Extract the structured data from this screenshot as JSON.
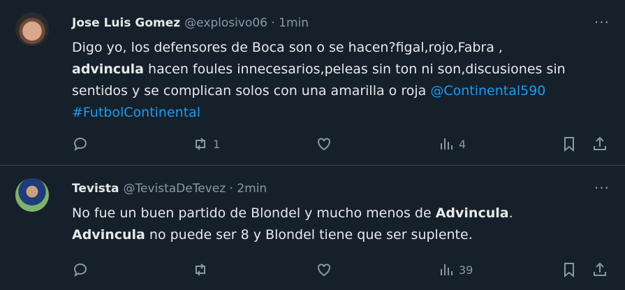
{
  "tweets": [
    {
      "name": "Jose Luis Gomez",
      "handle": "@explosivo06 · 1min",
      "more": "···",
      "body1": "Digo yo, los defensores de Boca son o se hacen?figal,rojo,Fabra ,",
      "body2_bold": "advincula",
      "body2_rest": " hacen foules innecesarios,peleas sin ton ni son,discusiones sin",
      "body3": "sentidos y se complican solos con una amarilla o roja ",
      "mention": "@Continental590",
      "hashtag": "#FutbolContinental",
      "retweets": "1",
      "views": "4",
      "icons": [
        "reply-icon",
        "retweet-icon",
        "like-icon",
        "views-icon",
        "bookmark-icon",
        "share-icon"
      ]
    },
    {
      "name": "Tevista",
      "handle": "@TevistaDeTevez · 2min",
      "more": "···",
      "l1a": "No fue un buen partido de Blondel y mucho menos de ",
      "l1b": "Advincula",
      "l1c": ".",
      "l2a": "Advincula",
      "l2b": " no puede ser 8 y Blondel tiene que ser suplente.",
      "views": "39",
      "icons": [
        "reply-icon",
        "retweet-icon",
        "like-icon",
        "views-icon",
        "bookmark-icon",
        "share-icon"
      ]
    }
  ],
  "colors": {
    "background": "#15202b",
    "text": "#e7e9ea",
    "muted": "#8b98a5",
    "link": "#1d9bf0"
  }
}
